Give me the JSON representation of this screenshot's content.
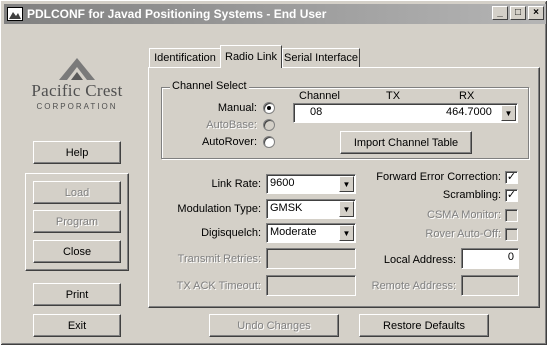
{
  "window": {
    "title": "PDLCONF for Javad Positioning Systems - End User",
    "minimize": "_",
    "maximize": "□",
    "close": "×"
  },
  "logo": {
    "name": "Pacific Crest",
    "subtitle": "CORPORATION"
  },
  "left_buttons": {
    "help": "Help",
    "load": "Load",
    "program": "Program",
    "close": "Close",
    "print": "Print",
    "exit": "Exit"
  },
  "tabs": [
    {
      "label": "Identification",
      "active": false
    },
    {
      "label": "Radio Link",
      "active": true
    },
    {
      "label": "Serial Interface",
      "active": false
    }
  ],
  "channel_select": {
    "title": "Channel Select",
    "manual_label": "Manual:",
    "autobase_label": "AutoBase:",
    "autorover_label": "AutoRover:",
    "selected_mode": "Manual",
    "col_channel": "Channel",
    "col_tx": "TX",
    "col_rx": "RX",
    "channel_value": "08",
    "rx_value": "464.7000",
    "import_button": "Import Channel Table"
  },
  "link_settings": {
    "link_rate_label": "Link Rate:",
    "link_rate_value": "9600",
    "modulation_label": "Modulation Type:",
    "modulation_value": "GMSK",
    "digisquelch_label": "Digisquelch:",
    "digisquelch_value": "Moderate",
    "transmit_retries_label": "Transmit Retries:",
    "transmit_retries_value": "",
    "tx_ack_label": "TX ACK Timeout:",
    "tx_ack_value": ""
  },
  "options": {
    "fec_label": "Forward Error Correction:",
    "fec_checked": true,
    "scrambling_label": "Scrambling:",
    "scrambling_checked": true,
    "csma_label": "CSMA Monitor:",
    "csma_checked": false,
    "rover_autooff_label": "Rover Auto-Off:",
    "rover_autooff_checked": false,
    "local_address_label": "Local Address:",
    "local_address_value": "0",
    "remote_address_label": "Remote Address:",
    "remote_address_value": ""
  },
  "bottom_buttons": {
    "undo": "Undo Changes",
    "restore": "Restore Defaults"
  },
  "glyphs": {
    "check": "✓",
    "dropdown": "▼"
  }
}
